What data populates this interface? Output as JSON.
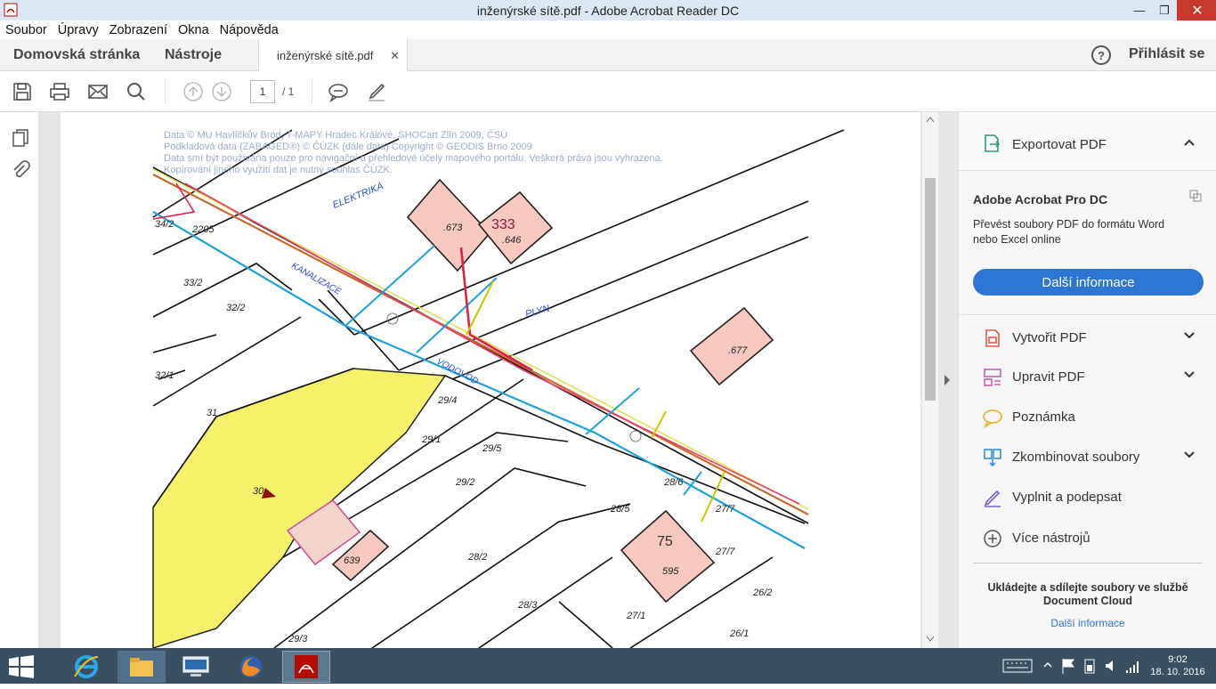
{
  "window": {
    "title": "inženýrské sítě.pdf - Adobe Acrobat Reader DC"
  },
  "menu": [
    "Soubor",
    "Úpravy",
    "Zobrazení",
    "Okna",
    "Nápověda"
  ],
  "nav": {
    "home": "Domovská stránka",
    "tools": "Nástroje",
    "tab": "inženýrské sítě.pdf",
    "help": "?",
    "signin": "Přihlásit se"
  },
  "toolbar": {
    "page_current": "1",
    "page_total": "/ 1"
  },
  "map": {
    "copyright": [
      "Data © MU Havlíčkův Brod, T-MAPY Hradec Králové, SHOCart Zlín 2009, ČSÚ",
      "Podkladová data (ZABAGED®) © ČÚZK (dále data) Copyright © GEODIS Brno 2009",
      "Data smí být používána pouze pro navigační a přehledové účely mapového portálu. Veškerá práva jsou vyhrazena.",
      "Kopírování jiného využití dat je nutný souhlas ČÚZK."
    ],
    "labels": {
      "elektrika": "ELEKTRIKA",
      "kanalizace": "KANALIZACE",
      "plyn": "PLYN",
      "vodovod": "VODOVOD",
      "b673": ".673",
      "b333": "333",
      "b646": ".646",
      "b677": ".677",
      "b75": "75",
      "b595": "595",
      "b639": "639",
      "p2205": "2205",
      "p342": "34/2",
      "p332": "33/2",
      "p322": "32/2",
      "p321": "32/1",
      "p31": "31",
      "p30": "30",
      "p294": "29/4",
      "p293": "29/3",
      "p291": "29/1",
      "p295": "29/5",
      "p292": "29/2",
      "p285": "28/5",
      "p282": "28/2",
      "p283": "28/3",
      "p2933": "29/3",
      "p277": "27/7",
      "p271": "27/1",
      "p262": "26/2",
      "p261": "26/1",
      "p286": "28/6",
      "p2717": "27/7"
    }
  },
  "rightpanel": {
    "export": "Exportovat PDF",
    "product": "Adobe Acrobat Pro DC",
    "desc1": "Převést soubory PDF do formátu Word",
    "desc2": "nebo Excel online",
    "cta": "Další informace",
    "tools": [
      {
        "label": "Vytvořit PDF",
        "icon": "create-pdf-icon",
        "color": "#e8574c"
      },
      {
        "label": "Upravit PDF",
        "icon": "edit-pdf-icon",
        "color": "#c95fb0"
      },
      {
        "label": "Poznámka",
        "icon": "comment-icon",
        "color": "#e7b73a"
      },
      {
        "label": "Zkombinovat soubory",
        "icon": "combine-files-icon",
        "color": "#3a8fd8"
      },
      {
        "label": "Vyplnit a podepsat",
        "icon": "fill-sign-icon",
        "color": "#7a5fc8"
      },
      {
        "label": "Více nástrojů",
        "icon": "more-tools-icon",
        "color": "#555555"
      }
    ],
    "cloud1": "Ukládejte a sdílejte soubory ve službě",
    "cloud2": "Document Cloud",
    "cloud_link": "Další informace"
  },
  "taskbar": {
    "time": "9:02",
    "date": "18. 10. 2016",
    "apps": [
      "internet-explorer-icon",
      "file-explorer-icon",
      "lenovo-icon",
      "firefox-icon",
      "acrobat-icon"
    ]
  }
}
